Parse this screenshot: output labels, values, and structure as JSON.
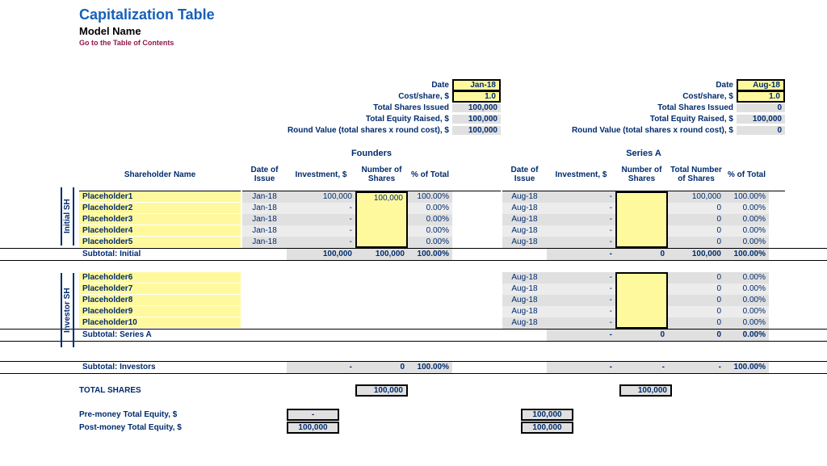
{
  "header": {
    "title": "Capitalization Table",
    "subtitle": "Model Name",
    "toc": "Go to the Table of Contents"
  },
  "rounds": {
    "founders": {
      "name": "Founders",
      "date_label": "Date",
      "date": "Jan-18",
      "cost_label": "Cost/share, $",
      "cost": "1.0",
      "shares_label": "Total Shares Issued",
      "shares": "100,000",
      "equity_label": "Total Equity Raised, $",
      "equity": "100,000",
      "rv_label": "Round Value (total shares x round cost), $",
      "rv": "100,000"
    },
    "seriesa": {
      "name": "Series A",
      "date_label": "Date",
      "date": "Aug-18",
      "cost_label": "Cost/share, $",
      "cost": "1.0",
      "shares_label": "Total Shares Issued",
      "shares": "0",
      "equity_label": "Total Equity Raised, $",
      "equity": "100,000",
      "rv_label": "Round Value (total shares x round cost), $",
      "rv": "0"
    }
  },
  "columns": {
    "shareholder": "Shareholder Name",
    "date": "Date of Issue",
    "inv": "Investment, $",
    "num": "Number of Shares",
    "total_num": "Total Number of Shares",
    "pct": "% of Total"
  },
  "labels": {
    "initial": "Initial SH",
    "investor": "Investor SH",
    "sub_initial": "Subtotal: Initial",
    "sub_seriesa": "Subtotal: Series A",
    "sub_investors": "Subtotal: Investors",
    "total_shares": "TOTAL SHARES",
    "pre_money": "Pre-money Total Equity, $",
    "post_money": "Post-money Total Equity, $"
  },
  "initial": [
    {
      "name": "Placeholder1",
      "f_date": "Jan-18",
      "f_inv": "100,000",
      "f_num": "100,000",
      "f_pct": "100.00%",
      "s_date": "Aug-18",
      "s_inv": "-",
      "s_num": "",
      "s_tot": "100,000",
      "s_pct": "100.00%"
    },
    {
      "name": "Placeholder2",
      "f_date": "Jan-18",
      "f_inv": "-",
      "f_num": "",
      "f_pct": "0.00%",
      "s_date": "Aug-18",
      "s_inv": "-",
      "s_num": "",
      "s_tot": "0",
      "s_pct": "0.00%"
    },
    {
      "name": "Placeholder3",
      "f_date": "Jan-18",
      "f_inv": "-",
      "f_num": "",
      "f_pct": "0.00%",
      "s_date": "Aug-18",
      "s_inv": "-",
      "s_num": "",
      "s_tot": "0",
      "s_pct": "0.00%"
    },
    {
      "name": "Placeholder4",
      "f_date": "Jan-18",
      "f_inv": "-",
      "f_num": "",
      "f_pct": "0.00%",
      "s_date": "Aug-18",
      "s_inv": "-",
      "s_num": "",
      "s_tot": "0",
      "s_pct": "0.00%"
    },
    {
      "name": "Placeholder5",
      "f_date": "Jan-18",
      "f_inv": "-",
      "f_num": "",
      "f_pct": "0.00%",
      "s_date": "Aug-18",
      "s_inv": "-",
      "s_num": "",
      "s_tot": "0",
      "s_pct": "0.00%"
    }
  ],
  "sub_initial": {
    "f_inv": "100,000",
    "f_num": "100,000",
    "f_pct": "100.00%",
    "s_inv": "-",
    "s_num": "0",
    "s_tot": "100,000",
    "s_pct": "100.00%"
  },
  "investors": [
    {
      "name": "Placeholder6",
      "s_date": "Aug-18",
      "s_inv": "-",
      "s_num": "",
      "s_tot": "0",
      "s_pct": "0.00%"
    },
    {
      "name": "Placeholder7",
      "s_date": "Aug-18",
      "s_inv": "-",
      "s_num": "",
      "s_tot": "0",
      "s_pct": "0.00%"
    },
    {
      "name": "Placeholder8",
      "s_date": "Aug-18",
      "s_inv": "-",
      "s_num": "",
      "s_tot": "0",
      "s_pct": "0.00%"
    },
    {
      "name": "Placeholder9",
      "s_date": "Aug-18",
      "s_inv": "-",
      "s_num": "",
      "s_tot": "0",
      "s_pct": "0.00%"
    },
    {
      "name": "Placeholder10",
      "s_date": "Aug-18",
      "s_inv": "-",
      "s_num": "",
      "s_tot": "0",
      "s_pct": "0.00%"
    }
  ],
  "sub_seriesa": {
    "s_inv": "-",
    "s_num": "0",
    "s_tot": "0",
    "s_pct": "0.00%"
  },
  "sub_investors": {
    "f_inv": "-",
    "f_num": "0",
    "f_pct": "100.00%",
    "s_inv": "-",
    "s_num": "-",
    "s_tot": "-",
    "s_pct": "100.00%"
  },
  "totals": {
    "founders_shares": "100,000",
    "seriesa_shares": "100,000",
    "founders_pre": "-",
    "founders_post": "100,000",
    "seriesa_pre": "100,000",
    "seriesa_post": "100,000"
  }
}
